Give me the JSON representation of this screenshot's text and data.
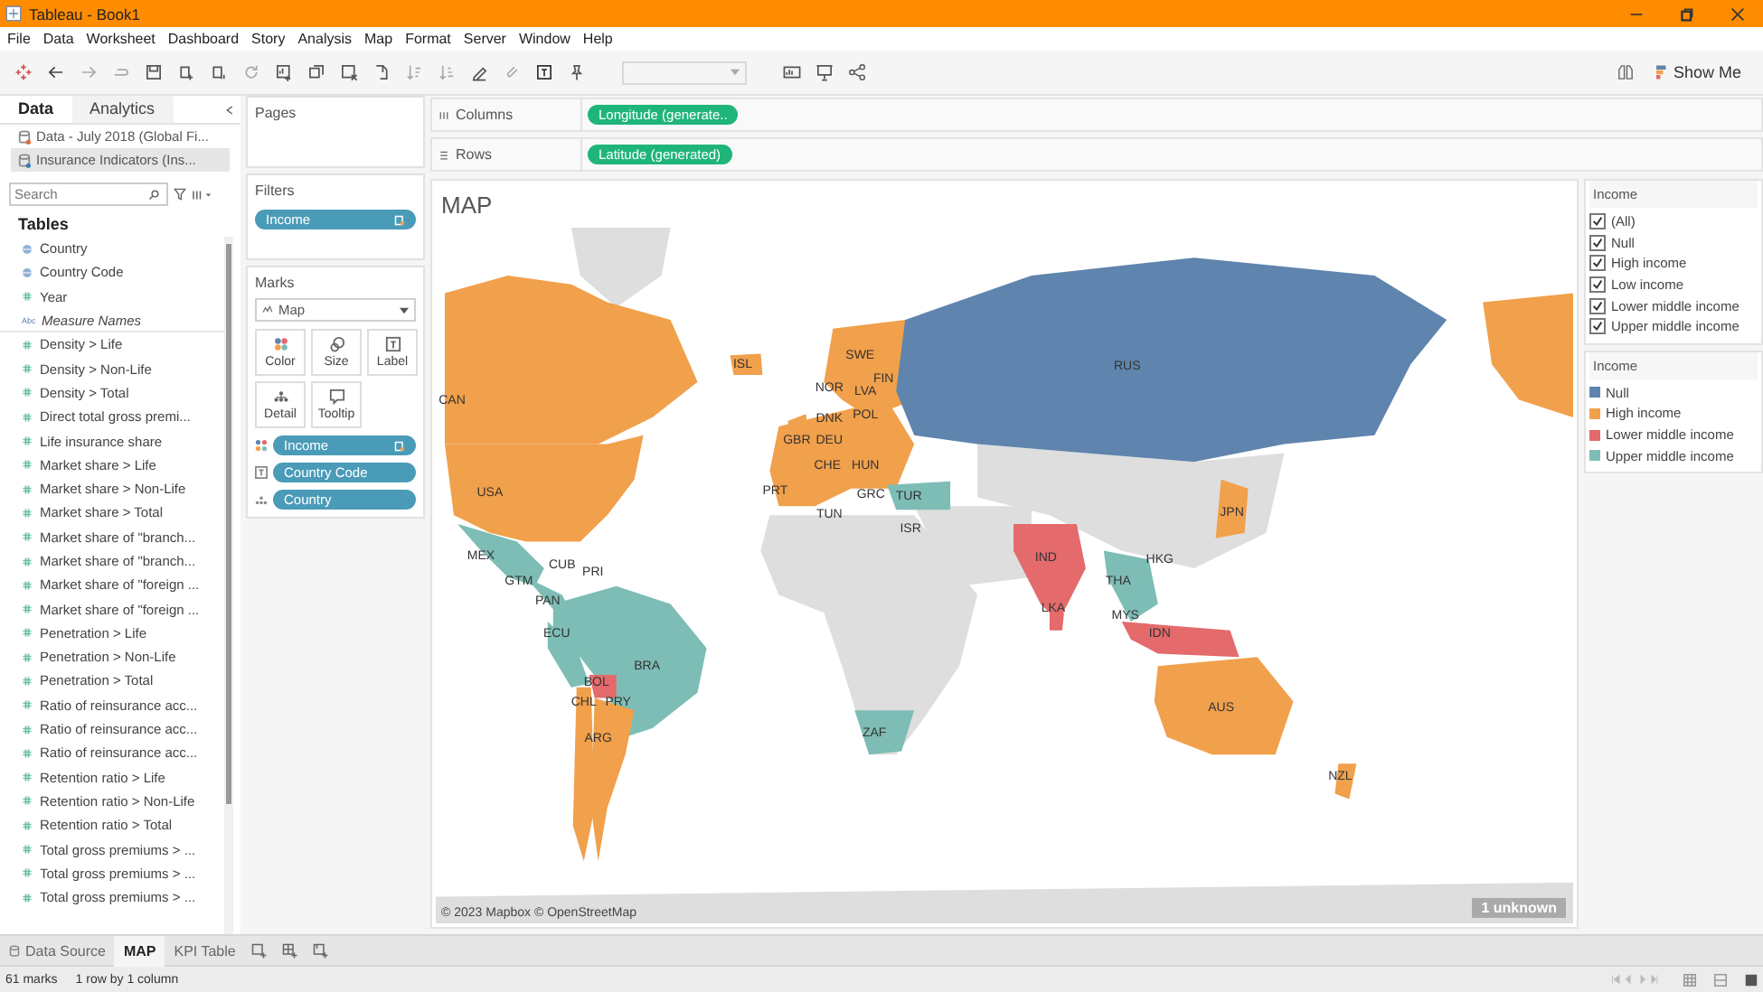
{
  "window": {
    "title": "Tableau - Book1"
  },
  "menu": [
    "File",
    "Data",
    "Worksheet",
    "Dashboard",
    "Story",
    "Analysis",
    "Map",
    "Format",
    "Server",
    "Window",
    "Help"
  ],
  "toolbar": {
    "show_me": "Show Me"
  },
  "side_tabs": [
    {
      "label": "Data",
      "selected": true
    },
    {
      "label": "Analytics",
      "selected": false
    }
  ],
  "data_sources": [
    {
      "name": "Data - July 2018 (Global Fi...",
      "selected": false
    },
    {
      "name": "Insurance Indicators (Ins...",
      "selected": true
    }
  ],
  "search": {
    "placeholder": "Search"
  },
  "tables_heading": "Tables",
  "fields": [
    {
      "name": "Country",
      "kind": "geo"
    },
    {
      "name": "Country Code",
      "kind": "geo"
    },
    {
      "name": "Year",
      "kind": "number"
    },
    {
      "name": "Measure Names",
      "kind": "text",
      "glyph": "Abc"
    },
    {
      "name": "Density > Life",
      "kind": "number"
    },
    {
      "name": "Density > Non-Life",
      "kind": "number"
    },
    {
      "name": "Density > Total",
      "kind": "number"
    },
    {
      "name": "Direct total gross premi...",
      "kind": "number"
    },
    {
      "name": "Life insurance share",
      "kind": "number"
    },
    {
      "name": "Market share > Life",
      "kind": "number"
    },
    {
      "name": "Market share > Non-Life",
      "kind": "number"
    },
    {
      "name": "Market share > Total",
      "kind": "number"
    },
    {
      "name": "Market share of \"branch...",
      "kind": "number"
    },
    {
      "name": "Market share of \"branch...",
      "kind": "number"
    },
    {
      "name": "Market share of \"foreign ...",
      "kind": "number"
    },
    {
      "name": "Market share of \"foreign ...",
      "kind": "number"
    },
    {
      "name": "Penetration > Life",
      "kind": "number"
    },
    {
      "name": "Penetration > Non-Life",
      "kind": "number"
    },
    {
      "name": "Penetration > Total",
      "kind": "number"
    },
    {
      "name": "Ratio of reinsurance acc...",
      "kind": "number"
    },
    {
      "name": "Ratio of reinsurance acc...",
      "kind": "number"
    },
    {
      "name": "Ratio of reinsurance acc...",
      "kind": "number"
    },
    {
      "name": "Retention ratio > Life",
      "kind": "number"
    },
    {
      "name": "Retention ratio > Non-Life",
      "kind": "number"
    },
    {
      "name": "Retention ratio > Total",
      "kind": "number"
    },
    {
      "name": "Total gross premiums > ...",
      "kind": "number"
    },
    {
      "name": "Total gross premiums > ...",
      "kind": "number"
    },
    {
      "name": "Total gross premiums > ...",
      "kind": "number"
    }
  ],
  "pages": {
    "title": "Pages"
  },
  "filters": {
    "title": "Filters",
    "pills": [
      "Income"
    ]
  },
  "marks": {
    "title": "Marks",
    "type": "Map",
    "cards": [
      {
        "label": "Color",
        "kind": "color"
      },
      {
        "label": "Size",
        "kind": "size"
      },
      {
        "label": "Label",
        "kind": "label"
      },
      {
        "label": "Detail",
        "kind": "detail"
      },
      {
        "label": "Tooltip",
        "kind": "tooltip"
      }
    ],
    "pills": [
      {
        "name": "Income",
        "kind": "color"
      },
      {
        "name": "Country Code",
        "kind": "label"
      },
      {
        "name": "Country",
        "kind": "detail"
      }
    ]
  },
  "shelves": [
    {
      "label": "Columns",
      "pill": "Longitude (generate..",
      "kind": "columns"
    },
    {
      "label": "Rows",
      "pill": "Latitude (generated)",
      "kind": "rows"
    }
  ],
  "sheet": {
    "title": "MAP",
    "credit": "© 2023 Mapbox © OpenStreetMap",
    "unknown": "1 unknown",
    "map_labels": [
      "CAN",
      "USA",
      "MEX",
      "CUB",
      "PRI",
      "GTM",
      "PAN",
      "ECU",
      "BRA",
      "BOL",
      "CHL",
      "PRY",
      "ARG",
      "ISL",
      "SWE",
      "FIN",
      "NOR",
      "LVA",
      "DNK",
      "GBR",
      "DEU",
      "POL",
      "CHE",
      "HUN",
      "PRT",
      "GRC",
      "TUR",
      "TUN",
      "ISR",
      "RUS",
      "IND",
      "LKA",
      "THA",
      "HKG",
      "MYS",
      "IDN",
      "JPN",
      "AUS",
      "ZAF",
      "NZL"
    ]
  },
  "filter_card": {
    "title": "Income",
    "options": [
      {
        "label": "(All)",
        "checked": true
      },
      {
        "label": "Null",
        "checked": true
      },
      {
        "label": "High income",
        "checked": true
      },
      {
        "label": "Low income",
        "checked": true
      },
      {
        "label": "Lower middle income",
        "checked": true
      },
      {
        "label": "Upper middle income",
        "checked": true
      }
    ]
  },
  "legend": {
    "title": "Income",
    "items": [
      {
        "label": "Null",
        "color": "#5f84ad"
      },
      {
        "label": "High income",
        "color": "#f1a04b"
      },
      {
        "label": "Lower middle income",
        "color": "#e46a6b"
      },
      {
        "label": "Upper middle income",
        "color": "#7dbdb5"
      }
    ]
  },
  "sheet_tabs": [
    {
      "label": "Data Source",
      "kind": "source",
      "selected": false
    },
    {
      "label": "MAP",
      "kind": "sheet",
      "selected": true
    },
    {
      "label": "KPI Table",
      "kind": "sheet",
      "selected": false
    }
  ],
  "status": {
    "marks": "61 marks",
    "layout": "1 row by 1 column"
  }
}
